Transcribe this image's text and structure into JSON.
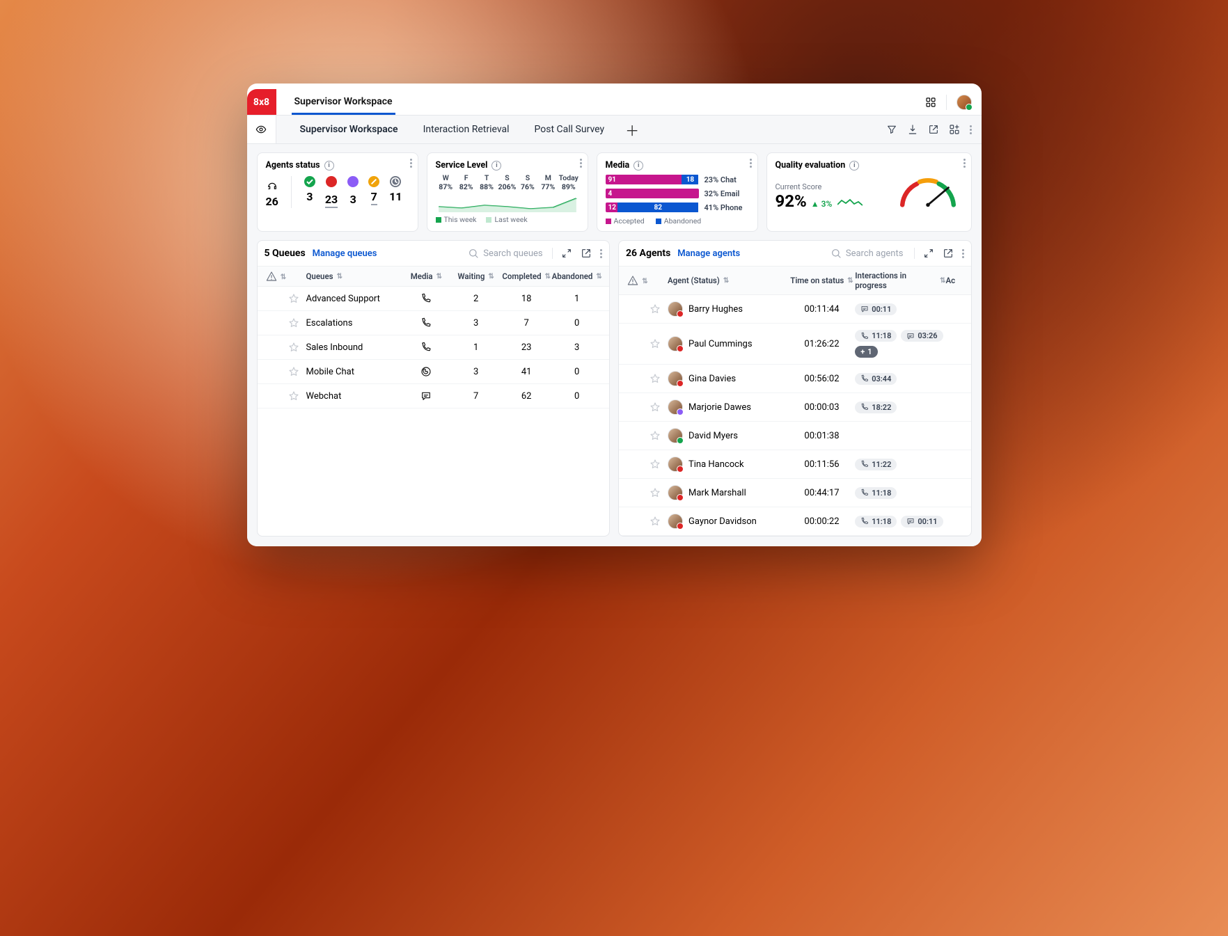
{
  "header": {
    "logo": "8x8",
    "title": "Supervisor Workspace"
  },
  "tabs": [
    {
      "label": "Supervisor Workspace",
      "active": true
    },
    {
      "label": "Interaction Retrieval",
      "active": false
    },
    {
      "label": "Post Call Survey",
      "active": false
    }
  ],
  "kpi": {
    "agents_status": {
      "title": "Agents status",
      "total": "26",
      "items": [
        {
          "color": "#14a44d",
          "icon": "check",
          "value": "3"
        },
        {
          "color": "#dc2626",
          "icon": "dot",
          "value": "23",
          "underline": true
        },
        {
          "color": "#8b5cf6",
          "icon": "dot",
          "value": "3"
        },
        {
          "color": "#f0a30a",
          "icon": "pencil",
          "value": "7",
          "underline": true
        },
        {
          "color": "#6b7280",
          "icon": "clock",
          "value": "11"
        }
      ]
    },
    "service_level": {
      "title": "Service Level",
      "days": [
        {
          "dow": "W",
          "pct": "87%"
        },
        {
          "dow": "F",
          "pct": "82%"
        },
        {
          "dow": "T",
          "pct": "88%"
        },
        {
          "dow": "S",
          "pct": "206%"
        },
        {
          "dow": "S",
          "pct": "76%"
        },
        {
          "dow": "M",
          "pct": "77%"
        },
        {
          "dow": "Today",
          "pct": "89%"
        }
      ],
      "legend_this": "This week",
      "legend_last": "Last week"
    },
    "media": {
      "title": "Media",
      "rows": [
        {
          "accepted": "91",
          "abandoned": "18",
          "acc_w": 82,
          "abn_w": 18,
          "pct": "23%",
          "label": "Chat"
        },
        {
          "accepted": "4",
          "abandoned": "",
          "acc_w": 100,
          "abn_w": 0,
          "pct": "32%",
          "label": "Email"
        },
        {
          "accepted": "12",
          "abandoned": "82",
          "acc_w": 13,
          "abn_w": 87,
          "pct": "41%",
          "label": "Phone"
        }
      ],
      "legend_acc": "Accepted",
      "legend_abn": "Abandoned"
    },
    "quality": {
      "title": "Quality evaluation",
      "sub": "Current Score",
      "score": "92%",
      "delta": "▲ 3%"
    }
  },
  "queues_panel": {
    "count_label": "5 Queues",
    "manage": "Manage queues",
    "search_placeholder": "Search queues",
    "headers": {
      "queues": "Queues",
      "media": "Media",
      "waiting": "Waiting",
      "completed": "Completed",
      "abandoned": "Abandoned"
    },
    "rows": [
      {
        "name": "Advanced Support",
        "media": "phone",
        "waiting": "2",
        "completed": "18",
        "abandoned": "1"
      },
      {
        "name": "Escalations",
        "media": "phone",
        "waiting": "3",
        "completed": "7",
        "abandoned": "0"
      },
      {
        "name": "Sales Inbound",
        "media": "phone",
        "waiting": "1",
        "completed": "23",
        "abandoned": "3"
      },
      {
        "name": "Mobile Chat",
        "media": "whatsapp",
        "waiting": "3",
        "completed": "41",
        "abandoned": "0"
      },
      {
        "name": "Webchat",
        "media": "chat",
        "waiting": "7",
        "completed": "62",
        "abandoned": "0"
      }
    ]
  },
  "agents_panel": {
    "count_label": "26 Agents",
    "manage": "Manage agents",
    "search_placeholder": "Search agents",
    "headers": {
      "agent": "Agent (Status)",
      "time": "Time on status",
      "prog": "Interactions in progress",
      "ac": "Ac"
    },
    "rows": [
      {
        "name": "Barry Hughes",
        "status": "red",
        "time": "00:11:44",
        "chips": [
          {
            "icon": "chat",
            "text": "00:11"
          }
        ]
      },
      {
        "name": "Paul Cummings",
        "status": "red",
        "time": "01:26:22",
        "chips": [
          {
            "icon": "phone",
            "text": "11:18"
          },
          {
            "icon": "chat",
            "text": "03:26"
          },
          {
            "icon": "plus",
            "text": "1",
            "dark": true
          }
        ]
      },
      {
        "name": "Gina Davies",
        "status": "red",
        "time": "00:56:02",
        "chips": [
          {
            "icon": "phone",
            "text": "03:44"
          }
        ]
      },
      {
        "name": "Marjorie Dawes",
        "status": "purple",
        "time": "00:00:03",
        "chips": [
          {
            "icon": "phone",
            "text": "18:22"
          }
        ]
      },
      {
        "name": "David Myers",
        "status": "green",
        "time": "00:01:38",
        "chips": []
      },
      {
        "name": "Tina Hancock",
        "status": "red",
        "time": "00:11:56",
        "chips": [
          {
            "icon": "phone",
            "text": "11:22"
          }
        ]
      },
      {
        "name": "Mark Marshall",
        "status": "red",
        "time": "00:44:17",
        "chips": [
          {
            "icon": "phone",
            "text": "11:18"
          }
        ]
      },
      {
        "name": "Gaynor Davidson",
        "status": "red",
        "time": "00:00:22",
        "chips": [
          {
            "icon": "phone",
            "text": "11:18"
          },
          {
            "icon": "chat",
            "text": "00:11"
          }
        ]
      }
    ]
  },
  "chart_data": {
    "service_level": {
      "type": "line",
      "title": "Service Level",
      "categories": [
        "W",
        "F",
        "T",
        "S",
        "S",
        "M",
        "Today"
      ],
      "series": [
        {
          "name": "This week",
          "values": [
            87,
            82,
            88,
            206,
            76,
            77,
            89
          ]
        },
        {
          "name": "Last week",
          "values": [
            90,
            85,
            84,
            95,
            80,
            78,
            82
          ]
        }
      ],
      "ylabel": "%"
    },
    "media_stacked": {
      "type": "bar",
      "title": "Media",
      "categories": [
        "Chat",
        "Email",
        "Phone"
      ],
      "series": [
        {
          "name": "Accepted",
          "values": [
            91,
            4,
            12
          ]
        },
        {
          "name": "Abandoned",
          "values": [
            18,
            0,
            82
          ]
        }
      ],
      "share_pct": {
        "Chat": 23,
        "Email": 32,
        "Phone": 41
      }
    },
    "quality_gauge": {
      "type": "gauge",
      "title": "Quality evaluation",
      "value": 92,
      "delta": 3,
      "range": [
        0,
        100
      ]
    },
    "agents_status_counts": {
      "type": "bar",
      "title": "Agents status",
      "categories": [
        "Available",
        "Busy",
        "Away",
        "Wrap-up",
        "Offline"
      ],
      "values": [
        3,
        23,
        3,
        7,
        11
      ],
      "total": 26
    }
  }
}
